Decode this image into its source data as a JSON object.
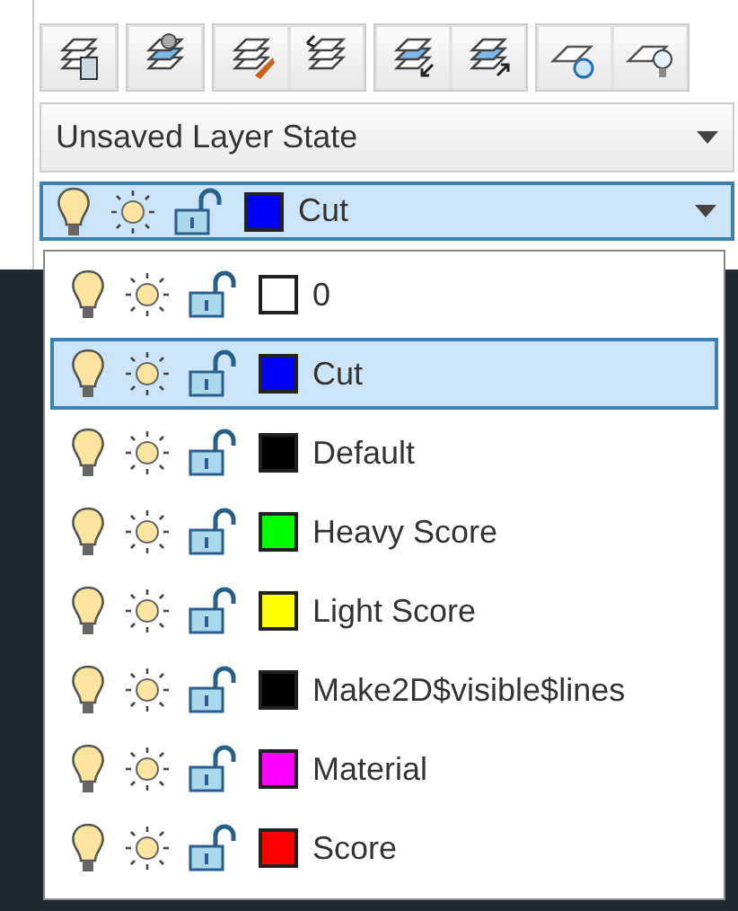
{
  "layer_state": {
    "value": "Unsaved Layer State"
  },
  "current_layer": {
    "name": "Cut",
    "on": true,
    "frozen": false,
    "locked": false,
    "color": "#0000ff"
  },
  "layers": [
    {
      "name": "0",
      "on": true,
      "frozen": false,
      "locked": false,
      "color": "#ffffff",
      "selected": false
    },
    {
      "name": "Cut",
      "on": true,
      "frozen": false,
      "locked": false,
      "color": "#0000ff",
      "selected": true
    },
    {
      "name": "Default",
      "on": true,
      "frozen": false,
      "locked": false,
      "color": "#000000",
      "selected": false
    },
    {
      "name": "Heavy Score",
      "on": true,
      "frozen": false,
      "locked": false,
      "color": "#00ff00",
      "selected": false
    },
    {
      "name": "Light Score",
      "on": true,
      "frozen": false,
      "locked": false,
      "color": "#ffff00",
      "selected": false
    },
    {
      "name": "Make2D$visible$lines",
      "on": true,
      "frozen": false,
      "locked": false,
      "color": "#000000",
      "selected": false
    },
    {
      "name": "Material",
      "on": true,
      "frozen": false,
      "locked": false,
      "color": "#ff00ff",
      "selected": false
    },
    {
      "name": "Score",
      "on": true,
      "frozen": false,
      "locked": false,
      "color": "#ff0000",
      "selected": false
    }
  ]
}
